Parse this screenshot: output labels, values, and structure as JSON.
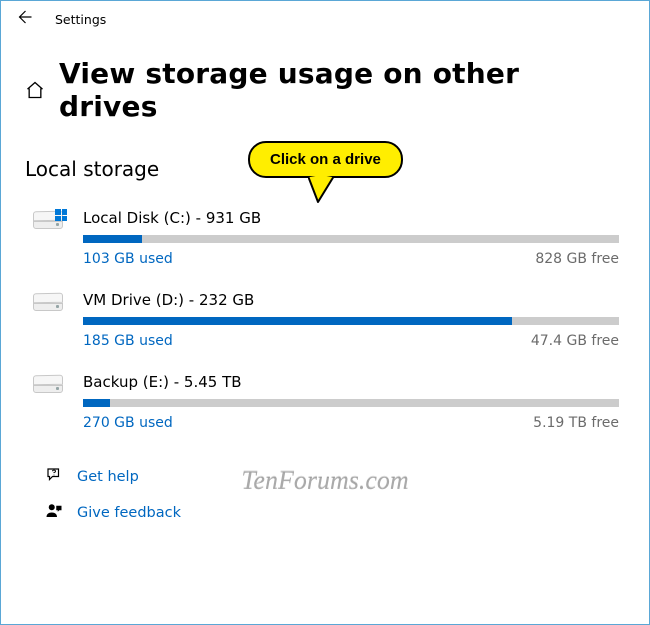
{
  "app": {
    "title": "Settings"
  },
  "page": {
    "title": "View storage usage on other drives"
  },
  "section": {
    "title": "Local storage"
  },
  "drives": [
    {
      "name": "Local Disk (C:) - 931 GB",
      "used": "103 GB used",
      "free": "828 GB free",
      "fill_percent": 11,
      "icon": "windows-drive"
    },
    {
      "name": "VM Drive (D:) - 232 GB",
      "used": "185 GB used",
      "free": "47.4 GB free",
      "fill_percent": 80,
      "icon": "drive"
    },
    {
      "name": "Backup (E:) - 5.45 TB",
      "used": "270 GB used",
      "free": "5.19 TB free",
      "fill_percent": 5,
      "icon": "drive"
    }
  ],
  "links": {
    "get_help": "Get help",
    "give_feedback": "Give feedback"
  },
  "callout": {
    "text": "Click on a drive"
  },
  "watermark": "TenForums.com",
  "colors": {
    "accent": "#0067c0",
    "bar_bg": "#cccccc",
    "callout_bg": "#ffee00"
  }
}
